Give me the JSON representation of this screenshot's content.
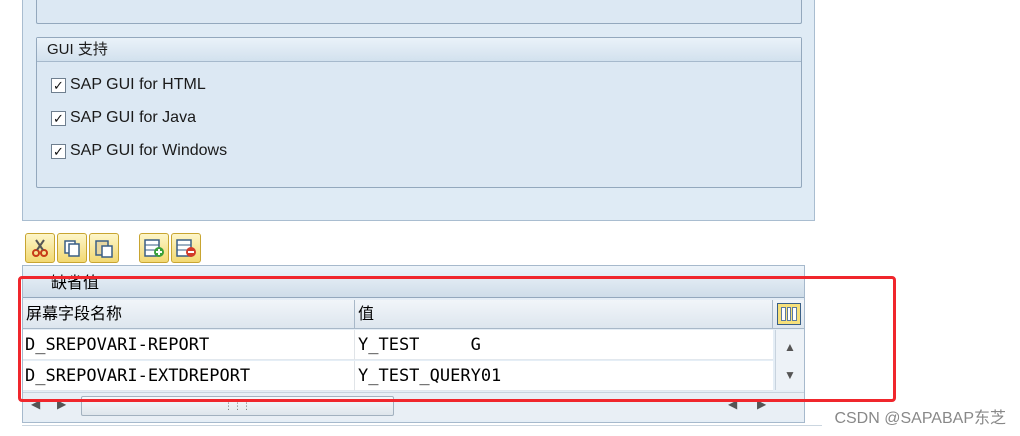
{
  "gui_support": {
    "title": "GUI 支持",
    "options": [
      {
        "label": "SAP GUI for HTML",
        "checked": true
      },
      {
        "label": "SAP GUI for Java",
        "checked": true
      },
      {
        "label": "SAP GUI for Windows",
        "checked": true
      }
    ]
  },
  "toolbar": {
    "buttons": [
      {
        "icon": "scissors-icon",
        "name": "cut-button"
      },
      {
        "icon": "copy-icon",
        "name": "copy-button"
      },
      {
        "icon": "paste-icon",
        "name": "paste-button"
      },
      {
        "icon": "insert-row-icon",
        "name": "insert-row-button"
      },
      {
        "icon": "delete-row-icon",
        "name": "delete-row-button"
      }
    ]
  },
  "defaults_table": {
    "title": "缺省值",
    "columns": [
      "屏幕字段名称",
      "值"
    ],
    "rows": [
      {
        "field": "D_SREPOVARI-REPORT",
        "value": "Y_TEST     G"
      },
      {
        "field": "D_SREPOVARI-EXTDREPORT",
        "value": "Y_TEST_QUERY01"
      }
    ]
  },
  "watermark": "CSDN @SAPABAP东芝",
  "colors": {
    "panel": "#dfebf5",
    "highlight": "#f0262c",
    "button_yellow": "#f2d872"
  }
}
